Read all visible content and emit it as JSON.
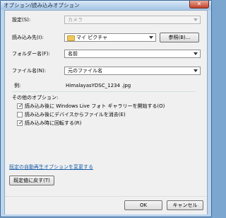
{
  "window": {
    "title": "オプション/読み込みオプション",
    "close_glyph": "✕"
  },
  "settings": {
    "setting_label": "設定(S):",
    "setting_value": "カメラ",
    "import_to_label": "読み込み先(I):",
    "import_to_value": "マイ ピクチャ",
    "browse_button": "参照(B)...",
    "folder_name_label": "フォルダー名(F):",
    "folder_name_value": "名前",
    "file_name_label": "ファイル名(N):",
    "file_name_value": "元のファイル名",
    "example_label": "例:",
    "example_value": "HimalayasYDSC_1234 .jpg"
  },
  "other_options": {
    "heading": "その他のオプション:",
    "items": [
      {
        "label": "読み込み後に Windows Live フォト ギャラリーを開始する(O)",
        "checked": true
      },
      {
        "label": "読み込み後にデバイスからファイルを消去(E)",
        "checked": false
      },
      {
        "label": "読み込み時に回転する(R)",
        "checked": true
      }
    ],
    "check_glyph": "✓"
  },
  "links": {
    "autoplay_link": "既定の自動再生オプションを変更する"
  },
  "buttons": {
    "restore_defaults": "既定値に戻す(T)",
    "ok": "OK",
    "cancel": "キャンセル"
  }
}
